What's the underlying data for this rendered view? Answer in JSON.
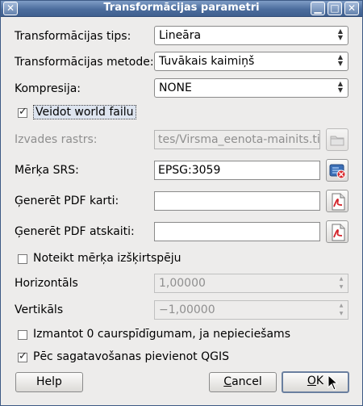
{
  "window": {
    "title": "Transformācijas parametri",
    "controls": {
      "minimize": "▁",
      "maximize": "□",
      "close": "✕"
    }
  },
  "form": {
    "transform_type": {
      "label": "Transformācijas tips:",
      "value": "Lineāra"
    },
    "transform_method": {
      "label": "Transformācijas metode:",
      "value": "Tuvākais kaimiņš"
    },
    "compression": {
      "label": "Kompresija:",
      "value": "NONE"
    },
    "world_file": {
      "label": "Veidot world failu",
      "checked": true
    },
    "output_raster": {
      "label": "Izvades rastrs:",
      "value": "tes/Virsma_eenota-mainits.tif"
    },
    "target_srs": {
      "label": "Mērķa SRS:",
      "value": "EPSG:3059"
    },
    "pdf_map": {
      "label": "Ģenerēt PDF karti:",
      "value": ""
    },
    "pdf_report": {
      "label": "Ģenerēt PDF atskaiti:",
      "value": ""
    },
    "set_resolution": {
      "label": "Noteikt mērķa izšķirtspēju",
      "checked": false
    },
    "horizontal": {
      "label": "Horizontāls",
      "value": "1,00000"
    },
    "vertical": {
      "label": "Vertikāls",
      "value": "−1,00000"
    },
    "transparency": {
      "label": "Izmantot 0 caurspīdīgumam, ja nepieciešams",
      "checked": false
    },
    "add_to_qgis": {
      "label": "Pēc sagatavošanas pievienot QGIS",
      "checked": true
    }
  },
  "buttons": {
    "help": "Help",
    "cancel_first": "C",
    "cancel_rest": "ancel",
    "ok_first": "O",
    "ok_rest": "K"
  },
  "icons": {
    "folder": "folder-icon",
    "srs": "projection-globe-icon",
    "pdf": "pdf-icon"
  },
  "colors": {
    "titlebar": "#4c6d9d",
    "dialog_bg": "#edeceb"
  }
}
